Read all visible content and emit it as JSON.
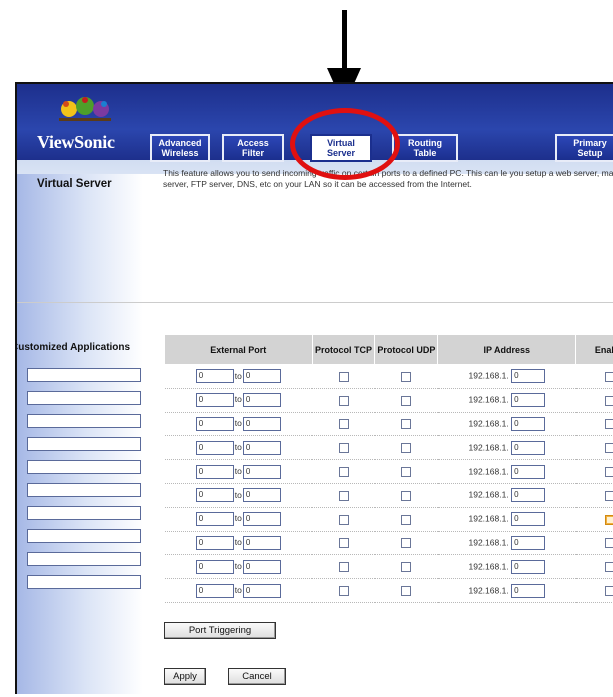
{
  "brand": {
    "name": "ViewSonic"
  },
  "tabs": [
    {
      "label": "Advanced Wireless"
    },
    {
      "label": "Access Filter"
    },
    {
      "label": "Virtual Server",
      "active": true
    },
    {
      "label": "Routing Table"
    },
    {
      "label": "Primary Setup"
    }
  ],
  "page": {
    "title": "Virtual Server",
    "description": "This feature allows you to send incoming traffic on certain ports to a defined PC. This can le you setup a web server, mail server, FTP server, DNS, etc on your LAN so it can be accessed from the Internet."
  },
  "customized_applications_label": "Customized Applications",
  "table": {
    "headers": [
      "External Port",
      "Protocol TCP",
      "Protocol UDP",
      "IP Address",
      "Enable"
    ],
    "to_label": "to",
    "ip_prefix": "192.168.1.",
    "rows": [
      {
        "port_from": "0",
        "port_to": "0",
        "tcp": false,
        "udp": false,
        "ip_last": "0",
        "enable": false
      },
      {
        "port_from": "0",
        "port_to": "0",
        "tcp": false,
        "udp": false,
        "ip_last": "0",
        "enable": false
      },
      {
        "port_from": "0",
        "port_to": "0",
        "tcp": false,
        "udp": false,
        "ip_last": "0",
        "enable": false
      },
      {
        "port_from": "0",
        "port_to": "0",
        "tcp": false,
        "udp": false,
        "ip_last": "0",
        "enable": false
      },
      {
        "port_from": "0",
        "port_to": "0",
        "tcp": false,
        "udp": false,
        "ip_last": "0",
        "enable": false
      },
      {
        "port_from": "0",
        "port_to": "0",
        "tcp": false,
        "udp": false,
        "ip_last": "0",
        "enable": false
      },
      {
        "port_from": "0",
        "port_to": "0",
        "tcp": false,
        "udp": false,
        "ip_last": "0",
        "enable": false,
        "enable_focused": true
      },
      {
        "port_from": "0",
        "port_to": "0",
        "tcp": false,
        "udp": false,
        "ip_last": "0",
        "enable": false
      },
      {
        "port_from": "0",
        "port_to": "0",
        "tcp": false,
        "udp": false,
        "ip_last": "0",
        "enable": false
      },
      {
        "port_from": "0",
        "port_to": "0",
        "tcp": false,
        "udp": false,
        "ip_last": "0",
        "enable": false
      }
    ]
  },
  "buttons": {
    "port_triggering": "Port Triggering",
    "apply": "Apply",
    "cancel": "Cancel"
  },
  "colors": {
    "brand_blue": "#1d2f8c",
    "annotation_red": "#e01010",
    "header_gray": "#d3d3d3"
  }
}
